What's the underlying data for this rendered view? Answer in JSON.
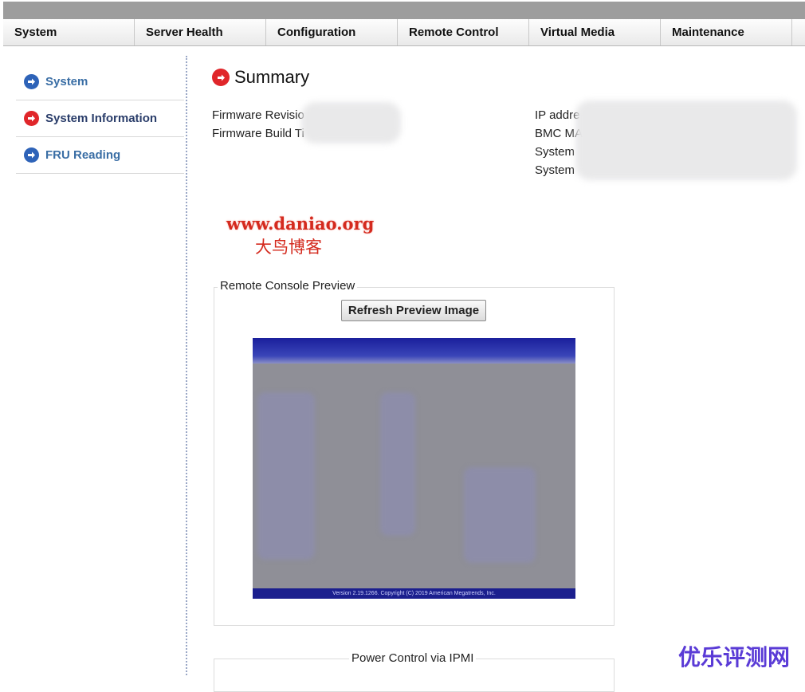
{
  "nav": [
    "System",
    "Server Health",
    "Configuration",
    "Remote Control",
    "Virtual Media",
    "Maintenance"
  ],
  "sidebar": {
    "items": [
      {
        "label": "System",
        "icon": "blue-arrow-icon"
      },
      {
        "label": "System Information",
        "icon": "red-arrow-icon"
      },
      {
        "label": "FRU Reading",
        "icon": "blue-arrow-icon"
      }
    ]
  },
  "summary": {
    "title": "Summary",
    "left_labels": [
      "Firmware Revisio",
      "Firmware Build Ti"
    ],
    "right_labels": [
      "IP addre",
      "BMC MA",
      "System",
      "System"
    ]
  },
  "watermark": {
    "url": "www.daniao.org",
    "name": "大鸟博客",
    "corner": "优乐评测网"
  },
  "preview": {
    "legend": "Remote Console Preview",
    "refresh_button": "Refresh Preview Image",
    "footer_text": "Version 2.19.1266. Copyright (C) 2019 American Megatrends, Inc."
  },
  "power": {
    "legend": "Power Control via IPMI"
  },
  "colors": {
    "accent_blue": "#2e63b8",
    "accent_red": "#e0262a",
    "link_blue": "#3a6ea5"
  }
}
